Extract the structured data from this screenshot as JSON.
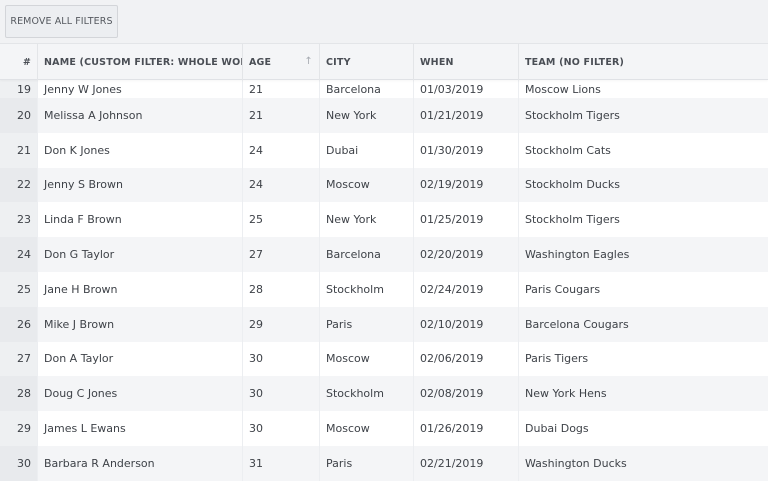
{
  "toolbar": {
    "remove_filters_label": "REMOVE ALL FILTERS"
  },
  "columns": [
    {
      "label": "#"
    },
    {
      "label": "NAME (CUSTOM FILTER: WHOLE WORDS)"
    },
    {
      "label": "AGE",
      "sort": "ascending"
    },
    {
      "label": "CITY"
    },
    {
      "label": "WHEN"
    },
    {
      "label": "TEAM (NO FILTER)"
    }
  ],
  "sort_icon": "arrow-up-icon",
  "rows": [
    {
      "num": "19",
      "name": "Jenny W Jones",
      "age": "21",
      "city": "Barcelona",
      "when": "01/03/2019",
      "team": "Moscow Lions"
    },
    {
      "num": "20",
      "name": "Melissa A Johnson",
      "age": "21",
      "city": "New York",
      "when": "01/21/2019",
      "team": "Stockholm Tigers"
    },
    {
      "num": "21",
      "name": "Don K Jones",
      "age": "24",
      "city": "Dubai",
      "when": "01/30/2019",
      "team": "Stockholm Cats"
    },
    {
      "num": "22",
      "name": "Jenny S Brown",
      "age": "24",
      "city": "Moscow",
      "when": "02/19/2019",
      "team": "Stockholm Ducks"
    },
    {
      "num": "23",
      "name": "Linda F Brown",
      "age": "25",
      "city": "New York",
      "when": "01/25/2019",
      "team": "Stockholm Tigers"
    },
    {
      "num": "24",
      "name": "Don G Taylor",
      "age": "27",
      "city": "Barcelona",
      "when": "02/20/2019",
      "team": "Washington Eagles"
    },
    {
      "num": "25",
      "name": "Jane H Brown",
      "age": "28",
      "city": "Stockholm",
      "when": "02/24/2019",
      "team": "Paris Cougars"
    },
    {
      "num": "26",
      "name": "Mike J Brown",
      "age": "29",
      "city": "Paris",
      "when": "02/10/2019",
      "team": "Barcelona Cougars"
    },
    {
      "num": "27",
      "name": "Don A Taylor",
      "age": "30",
      "city": "Moscow",
      "when": "02/06/2019",
      "team": "Paris Tigers"
    },
    {
      "num": "28",
      "name": "Doug C Jones",
      "age": "30",
      "city": "Stockholm",
      "when": "02/08/2019",
      "team": "New York Hens"
    },
    {
      "num": "29",
      "name": "James L Ewans",
      "age": "30",
      "city": "Moscow",
      "when": "01/26/2019",
      "team": "Dubai Dogs"
    },
    {
      "num": "30",
      "name": "Barbara R Anderson",
      "age": "31",
      "city": "Paris",
      "when": "02/21/2019",
      "team": "Washington Ducks"
    }
  ]
}
